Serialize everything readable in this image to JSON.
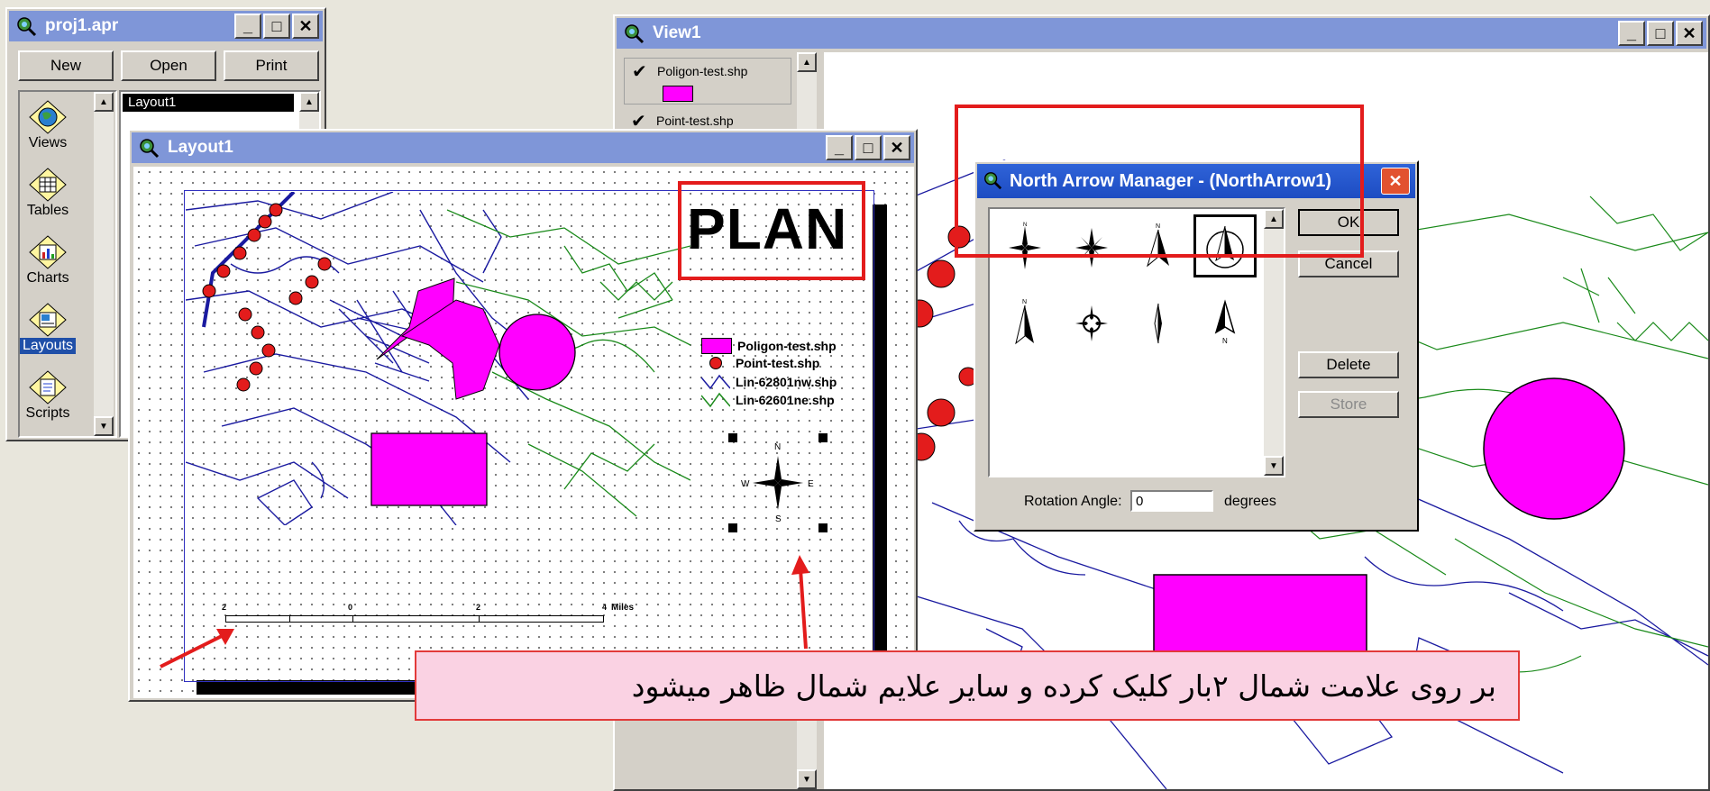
{
  "project_window": {
    "title": "proj1.apr",
    "buttons": {
      "new": "New",
      "open": "Open",
      "print": "Print"
    },
    "doc_types": [
      {
        "label": "Views",
        "icon": "globe-icon"
      },
      {
        "label": "Tables",
        "icon": "table-icon"
      },
      {
        "label": "Charts",
        "icon": "chart-icon"
      },
      {
        "label": "Layouts",
        "icon": "layout-icon",
        "selected": true
      },
      {
        "label": "Scripts",
        "icon": "script-icon"
      }
    ],
    "list_items": [
      "Layout1"
    ]
  },
  "view_window": {
    "title": "View1",
    "toc": [
      {
        "name": "Poligon-test.shp",
        "checked": true,
        "swatch": "#ff00ff"
      },
      {
        "name": "Point-test.shp",
        "checked": true
      }
    ]
  },
  "layout_window": {
    "title": "Layout1",
    "plan_title": "PLAN",
    "legend": [
      {
        "label": "Poligon-test.shp",
        "symbol": "polygon"
      },
      {
        "label": "Point-test.shp",
        "symbol": "point"
      },
      {
        "label": "Lin-62801nw.shp",
        "symbol": "line-blue"
      },
      {
        "label": "Lin-62601ne.shp",
        "symbol": "line-green"
      }
    ],
    "scalebar": {
      "ticks": [
        "2",
        "0",
        "2",
        "4"
      ],
      "units": "Miles"
    },
    "north_arrow_letters": {
      "n": "N",
      "s": "S",
      "e": "E",
      "w": "W"
    }
  },
  "north_arrow_dialog": {
    "title": "North Arrow Manager - (NorthArrow1)",
    "buttons": {
      "ok": "OK",
      "cancel": "Cancel",
      "delete": "Delete",
      "store": "Store"
    },
    "rotation_label": "Rotation Angle:",
    "rotation_value": "0",
    "rotation_units": "degrees",
    "selected_index": 3
  },
  "caption": "بر روی علامت شمال ۲بار کلیک کرده و سایر علایم شمال ظاهر میشود",
  "colors": {
    "titlebar": "#7f96d8",
    "highlight_red": "#e31c1c",
    "magenta": "#ff00ff",
    "map_blue": "#1a1aa0",
    "map_green": "#1a8a1a",
    "caption_bg": "#fad2e3"
  }
}
